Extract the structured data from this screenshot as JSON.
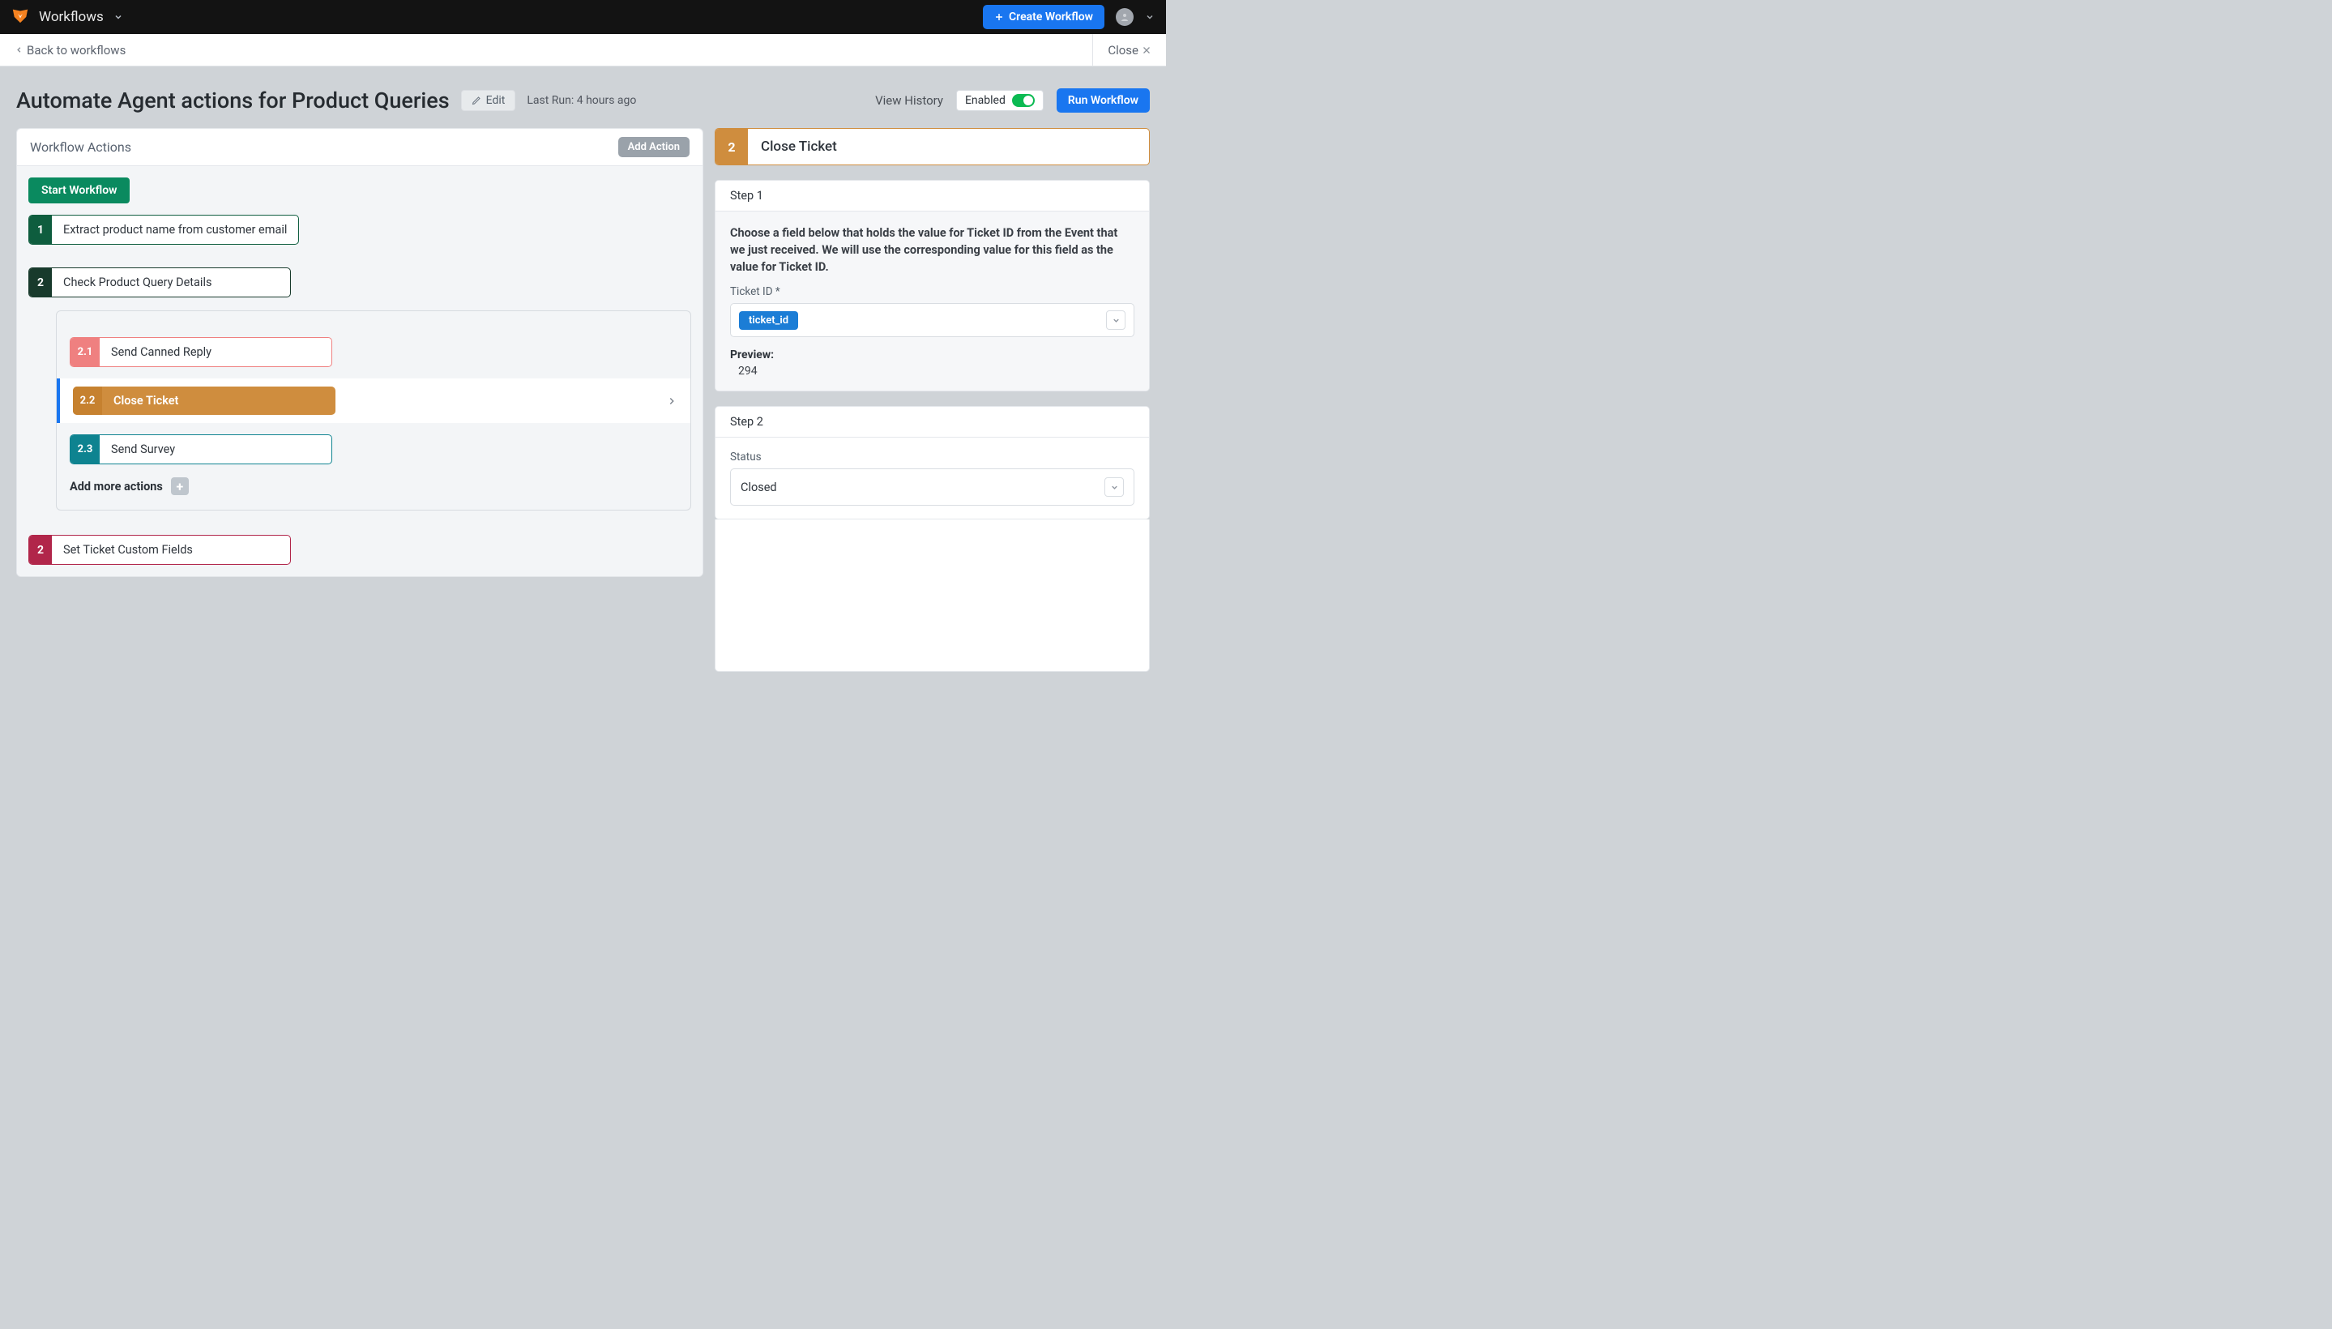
{
  "topbar": {
    "brand": "Workflows",
    "create_label": "Create Workflow"
  },
  "subbar": {
    "back_label": "Back to workflows",
    "close_label": "Close"
  },
  "header": {
    "title": "Automate Agent actions for Product Queries",
    "edit_label": "Edit",
    "last_run": "Last Run: 4 hours ago",
    "view_history": "View History",
    "enabled_label": "Enabled",
    "run_label": "Run Workflow"
  },
  "actions_panel": {
    "title": "Workflow Actions",
    "add_action_label": "Add Action",
    "start_label": "Start Workflow",
    "steps": {
      "s1": {
        "num": "1",
        "label": "Extract product name from customer email"
      },
      "s2": {
        "num": "2",
        "label": "Check Product Query Details"
      },
      "s2_1": {
        "num": "2.1",
        "label": "Send Canned Reply"
      },
      "s2_2": {
        "num": "2.2",
        "label": "Close Ticket"
      },
      "s2_3": {
        "num": "2.3",
        "label": "Send Survey"
      },
      "s3": {
        "num": "2",
        "label": "Set Ticket Custom Fields"
      }
    },
    "add_more_label": "Add more actions"
  },
  "detail": {
    "num": "2",
    "title": "Close Ticket",
    "step1": {
      "heading": "Step 1",
      "instruction": "Choose a field below that holds the value for Ticket ID from the Event that we just received. We will use the corresponding value for this field as the value for Ticket ID.",
      "field_label": "Ticket ID *",
      "token": "ticket_id",
      "preview_label": "Preview:",
      "preview_value": "294"
    },
    "step2": {
      "heading": "Step 2",
      "field_label": "Status",
      "value": "Closed"
    }
  }
}
